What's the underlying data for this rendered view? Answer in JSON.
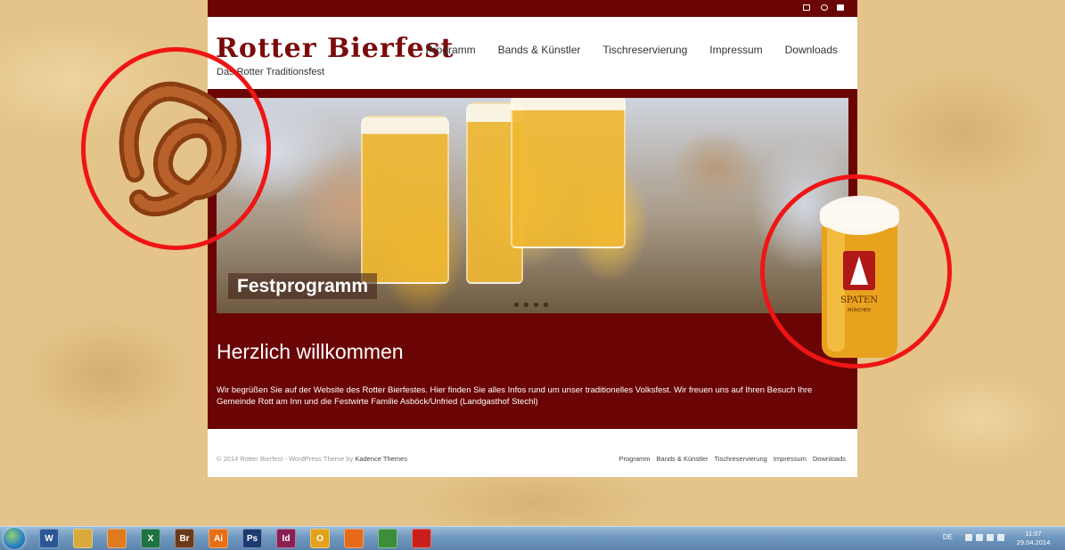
{
  "site": {
    "title": "Rotter Bierfest",
    "tagline": "Das Rotter Traditionsfest",
    "nav": [
      "Programm",
      "Bands & Künstler",
      "Tischreservierung",
      "Impressum",
      "Downloads"
    ],
    "hero_caption": "Festprogramm",
    "welcome_title": "Herzlich willkommen",
    "welcome_text": "Wir begrüßen Sie auf der Website des Rotter Bierfestes. Hier finden Sie alles Infos rund um unser traditionelles Volksfest. Wir freuen uns auf Ihren Besuch Ihre Gemeinde Rott am Inn und die Festwirte Familie Asböck/Unfried (Landgasthof Stechl)",
    "footer_copyright": "© 2014 Rotter Bierfest - WordPress Theme by ",
    "footer_theme": "Kadence Themes",
    "footer_nav": [
      "Programm",
      "Bands & Künstler",
      "Tischreservierung",
      "Impressum",
      "Downloads"
    ]
  },
  "colors": {
    "brand_red": "#6b0505",
    "logo_red": "#7a0b0b",
    "annotation_red": "#f01515"
  },
  "decor": {
    "mug_brand": "SPATEN",
    "mug_city": "MÜNCHEN"
  },
  "taskbar": {
    "apps": [
      {
        "name": "word-icon",
        "label": "W",
        "color": "#2b5797"
      },
      {
        "name": "file-explorer-icon",
        "label": "",
        "color": "#d9a93a"
      },
      {
        "name": "media-player-icon",
        "label": "",
        "color": "#e07a1f"
      },
      {
        "name": "excel-icon",
        "label": "X",
        "color": "#1f7244"
      },
      {
        "name": "bridge-icon",
        "label": "Br",
        "color": "#6b3a1a"
      },
      {
        "name": "illustrator-icon",
        "label": "Ai",
        "color": "#e86f16"
      },
      {
        "name": "photoshop-icon",
        "label": "Ps",
        "color": "#1c3b73"
      },
      {
        "name": "indesign-icon",
        "label": "Id",
        "color": "#8a1f54"
      },
      {
        "name": "outlook-icon",
        "label": "O",
        "color": "#e3a21a"
      },
      {
        "name": "firefox-icon",
        "label": "",
        "color": "#e66a1a"
      },
      {
        "name": "chrome-icon",
        "label": "",
        "color": "#3b8f3b"
      },
      {
        "name": "acrobat-icon",
        "label": "",
        "color": "#c8201d"
      }
    ],
    "language": "DE",
    "time": "11:07",
    "date": "29.04.2014"
  }
}
